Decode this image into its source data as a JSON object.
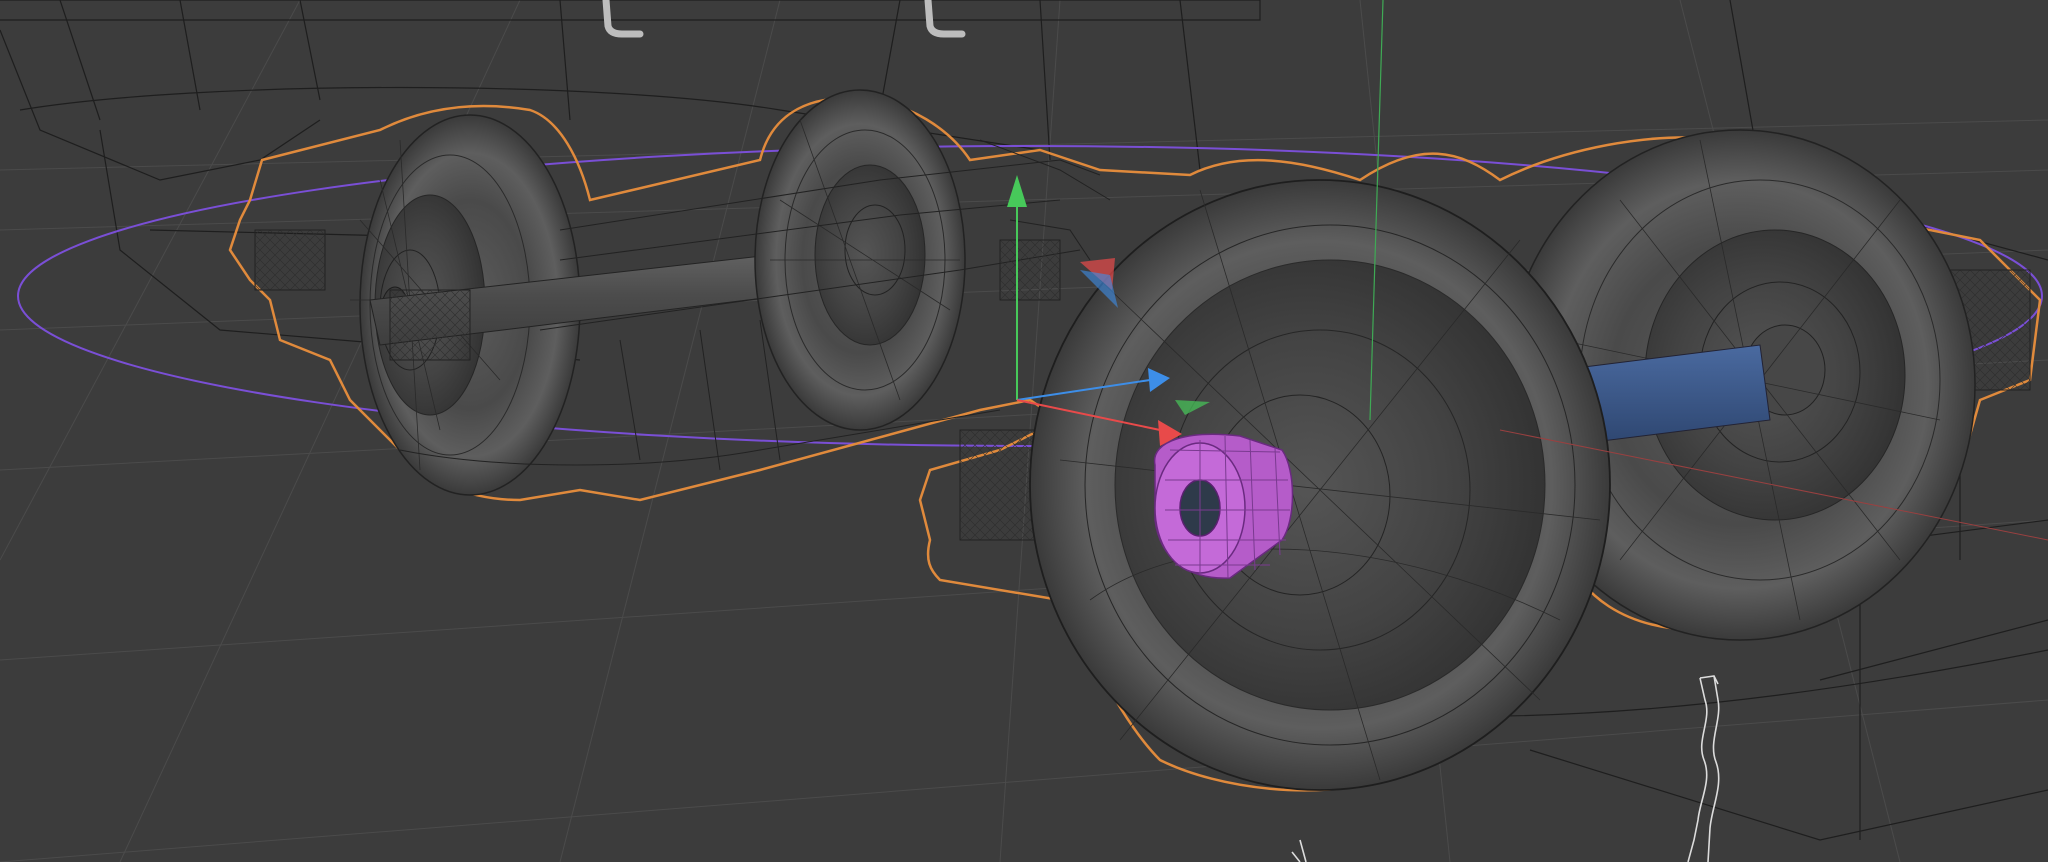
{
  "viewport": {
    "mode": "wireframe-xray",
    "background": "#3c3c3c",
    "grid_color": "#4a4a4a"
  },
  "scene": {
    "object": "bogie-wheelset",
    "selection_outline_color": "#e08a3c",
    "selected_face_color": "#b55cc9",
    "rotation_ring_color": "#7a4fd6",
    "highlighted_axle_color": "#3a5a8c"
  },
  "gizmo": {
    "x_axis_color": "#e84a4a",
    "y_axis_color": "#47c95a",
    "z_axis_color": "#3d8ee8",
    "axis_icons": [
      "arrow-x-icon",
      "arrow-y-icon",
      "arrow-z-icon"
    ]
  }
}
